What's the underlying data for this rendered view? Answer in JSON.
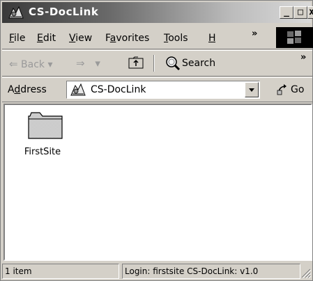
{
  "window": {
    "title": "CS-DocLink",
    "controls": {
      "minimize": "_",
      "maximize": "□",
      "close": "x"
    }
  },
  "menubar": {
    "items": [
      {
        "label": "File",
        "key": "F",
        "rest": "ile"
      },
      {
        "label": "Edit",
        "key": "E",
        "rest": "dit"
      },
      {
        "label": "View",
        "key": "V",
        "rest": "iew"
      },
      {
        "label": "Favorites",
        "pre": "F",
        "key": "a",
        "rest": "vorites"
      },
      {
        "label": "Tools",
        "key": "T",
        "rest": "ools"
      },
      {
        "label": "Help",
        "key": "H",
        "rest": ""
      }
    ],
    "overflow": "»"
  },
  "toolbar": {
    "back_label": "Back",
    "back_arrow": "⇐",
    "dropdown_glyph": "▾",
    "forward_arrow": "⇒",
    "search_label": "Search",
    "overflow": "»"
  },
  "address": {
    "label_key": "d",
    "label_pre": "A",
    "label_rest": "dress",
    "value": "CS-DocLink",
    "go_label": "Go"
  },
  "content": {
    "items": [
      {
        "name": "FirstSite",
        "icon": "folder-icon"
      }
    ]
  },
  "statusbar": {
    "count": "1 item",
    "info": "Login: firstsite  CS-DocLink: v1.0"
  }
}
